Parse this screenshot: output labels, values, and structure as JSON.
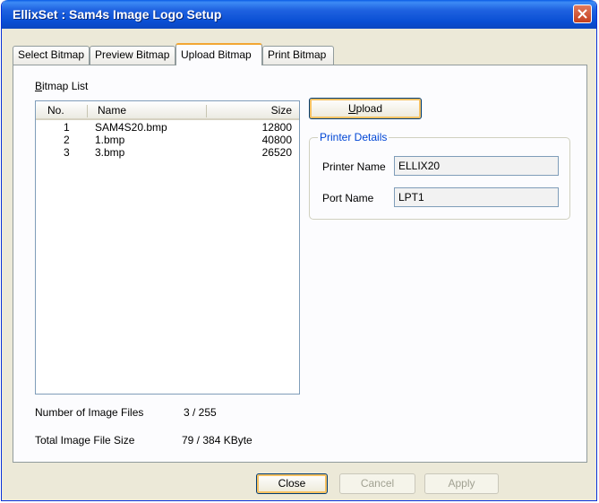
{
  "window": {
    "title": "EllixSet : Sam4s Image Logo Setup"
  },
  "tabs": [
    {
      "label": "Select Bitmap"
    },
    {
      "label": "Preview Bitmap"
    },
    {
      "label": "Upload Bitmap"
    },
    {
      "label": "Print Bitmap"
    }
  ],
  "active_tab": "Upload Bitmap",
  "bitmap_list": {
    "label_accel": "B",
    "label_rest": "itmap List",
    "columns": {
      "no": "No.",
      "name": "Name",
      "size": "Size"
    },
    "rows": [
      {
        "no": "1",
        "name": "SAM4S20.bmp",
        "size": "12800"
      },
      {
        "no": "2",
        "name": "1.bmp",
        "size": "40800"
      },
      {
        "no": "3",
        "name": "3.bmp",
        "size": "26520"
      }
    ]
  },
  "upload_button": {
    "accel": "U",
    "rest": "pload"
  },
  "printer_details": {
    "legend": "Printer Details",
    "printer_name_label": "Printer Name",
    "printer_name_value": "ELLIX20",
    "port_name_label": "Port Name",
    "port_name_value": "LPT1"
  },
  "stats": {
    "num_files_label": "Number of Image Files",
    "num_files_value": "3 / 255",
    "total_size_label": "Total Image File Size",
    "total_size_value": "79 / 384 KByte"
  },
  "footer": {
    "close": "Close",
    "cancel": "Cancel",
    "apply": "Apply"
  },
  "colors": {
    "title_bar": "#0a4fd4",
    "dialog_bg": "#ece9d8",
    "legend_text": "#0046d5",
    "active_tab_accent": "#f2a633"
  }
}
